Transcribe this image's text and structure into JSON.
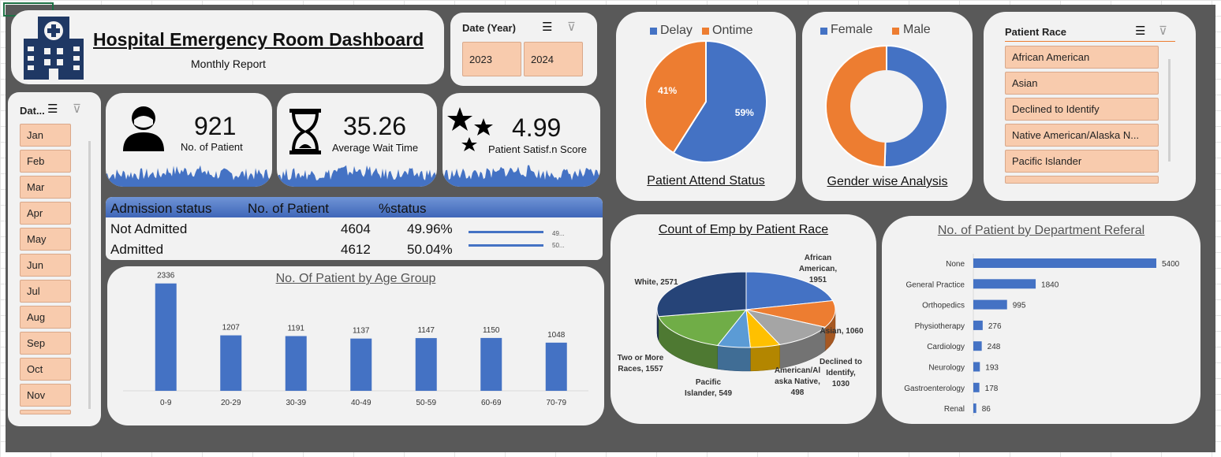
{
  "header": {
    "title": "Hospital Emergency Room Dashboard",
    "subtitle": "Monthly Report",
    "logo_icon": "hospital-icon"
  },
  "year_slicer": {
    "title": "Date (Year)",
    "items": [
      "2023",
      "2024"
    ]
  },
  "month_slicer": {
    "title": "Dat...",
    "items": [
      "Jan",
      "Feb",
      "Mar",
      "Apr",
      "May",
      "Jun",
      "Jul",
      "Aug",
      "Sep",
      "Oct",
      "Nov"
    ]
  },
  "race_slicer": {
    "title": "Patient Race",
    "items": [
      "African American",
      "Asian",
      "Declined to Identify",
      "Native American/Alaska N...",
      "Pacific Islander"
    ]
  },
  "kpis": [
    {
      "value": "921",
      "label": "No. of Patient",
      "icon": "person-icon"
    },
    {
      "value": "35.26",
      "label": "Average Wait Time",
      "icon": "hourglass-icon"
    },
    {
      "value": "4.99",
      "label": "Patient Satisf.n Score",
      "icon": "stars-icon"
    }
  ],
  "admission": {
    "headers": [
      "Admission status",
      "No. of Patient",
      "%status"
    ],
    "rows": [
      {
        "status": "Not Admitted",
        "count": "4604",
        "pct": "49.96%",
        "bar": 0.4996,
        "spark_label": "49..."
      },
      {
        "status": "Admitted",
        "count": "4612",
        "pct": "50.04%",
        "bar": 0.5004,
        "spark_label": "50..."
      }
    ]
  },
  "colors": {
    "blue": "#4472c4",
    "orange": "#ed7d31",
    "gray": "#a5a5a5",
    "gold": "#ffc000",
    "lightblue": "#5b9bd5",
    "green": "#70ad47",
    "navy": "#264478",
    "panel": "#f2f2f2",
    "slicer": "#f8cbad",
    "background": "#595959"
  },
  "chart_data": [
    {
      "id": "attend",
      "type": "pie",
      "title": "Patient Attend Status",
      "legend": [
        "Delay",
        "Ontime"
      ],
      "values": [
        59,
        41
      ],
      "labels": [
        "59%",
        "41%"
      ]
    },
    {
      "id": "gender",
      "type": "pie",
      "subtype": "doughnut",
      "title": "Gender wise Analysis",
      "legend": [
        "Female",
        "Male"
      ],
      "values": [
        50.5,
        49.5
      ]
    },
    {
      "id": "age",
      "type": "bar",
      "title": "No. Of Patient by Age Group",
      "categories": [
        "0-9",
        "20-29",
        "30-39",
        "40-49",
        "50-59",
        "60-69",
        "70-79"
      ],
      "values": [
        2336,
        1207,
        1191,
        1137,
        1147,
        1150,
        1048
      ],
      "ylim": [
        0,
        2400
      ]
    },
    {
      "id": "race",
      "type": "pie",
      "subtype": "3d",
      "title": "Count of Emp by Patient Race",
      "categories": [
        "African American",
        "Asian",
        "Declined to Identify",
        "American/Alaska Native",
        "Pacific Islander",
        "Two or More Races",
        "White"
      ],
      "values": [
        1951,
        1060,
        1030,
        498,
        549,
        1557,
        2571
      ],
      "labels": [
        "African American, 1951",
        "Asian, 1060",
        "Declined to Identify, 1030",
        "American/Al aska Native, 498",
        "Pacific Islander, 549",
        "Two or More Races, 1557",
        "White, 2571"
      ]
    },
    {
      "id": "dept",
      "type": "bar",
      "orientation": "horizontal",
      "title": "No. of Patient by Department Referal",
      "categories": [
        "None",
        "General Practice",
        "Orthopedics",
        "Physiotherapy",
        "Cardiology",
        "Neurology",
        "Gastroenterology",
        "Renal"
      ],
      "values": [
        5400,
        1840,
        995,
        276,
        248,
        193,
        178,
        86
      ],
      "xlim": [
        0,
        5400
      ]
    }
  ]
}
